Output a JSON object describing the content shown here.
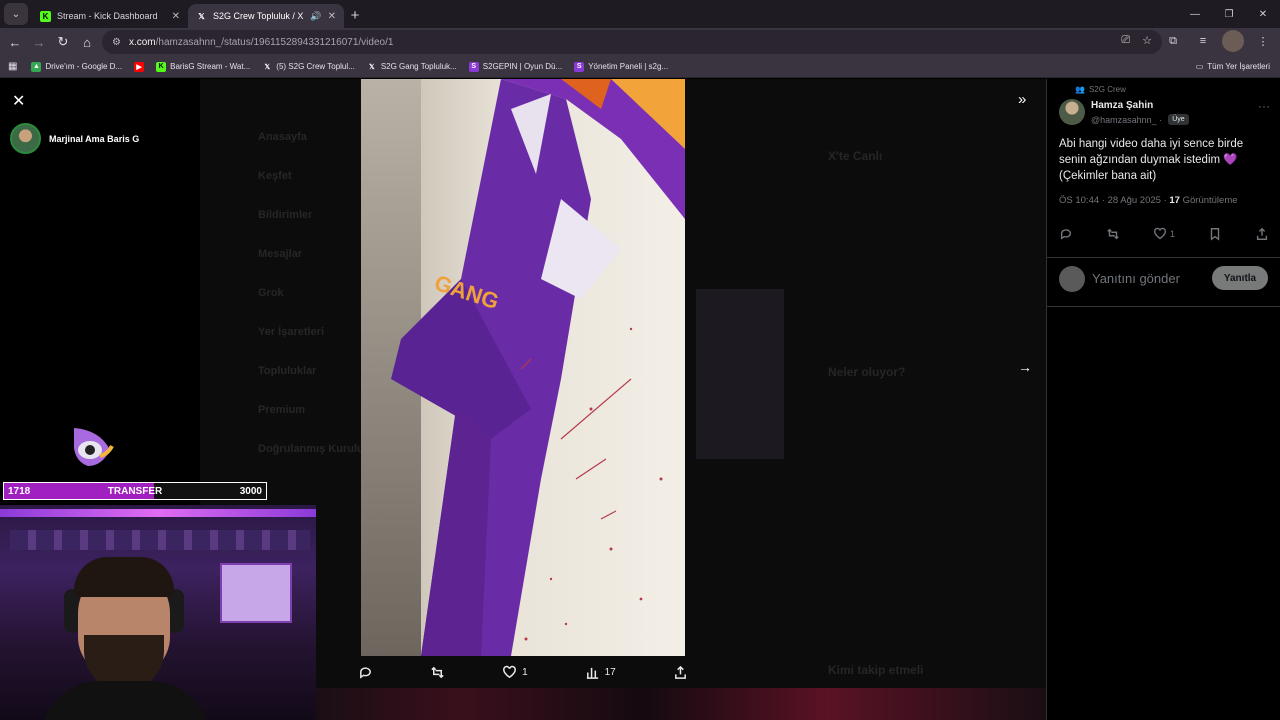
{
  "browser": {
    "tabs": [
      {
        "label": "Stream - Kick Dashboard",
        "favicon": "K",
        "active": false,
        "color": "#53fc18"
      },
      {
        "label": "S2G Crew Topluluk / X",
        "favicon": "X",
        "active": true,
        "color": "#ffffff"
      }
    ],
    "url_host": "x.com",
    "url_path": "/hamzasahnn_/status/1961152894331216071/video/1",
    "bookmarks": [
      {
        "label": "Drive'ım - Google D...",
        "icon": "drive-icon",
        "color": "#34a853"
      },
      {
        "label": "",
        "icon": "youtube-icon",
        "color": "#ff0000"
      },
      {
        "label": "BarisG Stream - Wat...",
        "icon": "kick-icon",
        "color": "#53fc18"
      },
      {
        "label": "(5) S2G Crew Toplul...",
        "icon": "x-icon",
        "color": "#ffffff"
      },
      {
        "label": "S2G Gang Topluluk...",
        "icon": "x-icon",
        "color": "#ffffff"
      },
      {
        "label": "S2GEPIN | Oyun Dü...",
        "icon": "s2g-icon",
        "color": "#8a3ad8"
      },
      {
        "label": "Yönetim Paneli | s2g...",
        "icon": "s2g-icon",
        "color": "#8a3ad8"
      }
    ],
    "all_bookmarks_label": "Tüm Yer İşaretleri"
  },
  "overlay": {
    "streamer_name": "Marjinal Ama Baris G",
    "transfer": {
      "current": "1718",
      "label": "TRANSFER",
      "goal": "3000",
      "progress": 0.573
    }
  },
  "background_ghost": {
    "nav": [
      "Anasayfa",
      "Keşfet",
      "Bildirimler",
      "Mesajlar",
      "Grok",
      "Yer İşaretleri",
      "Topluluklar",
      "Premium",
      "Doğrulanmış Kuruluşlar"
    ],
    "live_title": "X'te Canlı",
    "whats_happening": "Neler oluyor?",
    "who_to_follow": "Kimi takip etmeli"
  },
  "video_toolbar": {
    "reply_count": "",
    "retweet_count": "",
    "like_count": "1",
    "views_count": "17"
  },
  "post": {
    "community": "S2G Crew",
    "author_name": "Hamza Şahin",
    "author_handle": "@hamzasahnn_ ·",
    "badge": "Üye",
    "text_line1": "Abi hangi video daha iyi sence birde",
    "text_line2": "senin ağzından duymak istedim 💜",
    "text_line3": "(Çekimler bana ait)",
    "timestamp": "ÖS 10:44 · 28 Ağu 2025 · ",
    "views": "17",
    "views_label": " Görüntüleme",
    "like_count": "1",
    "reply_placeholder": "Yanıtını gönder",
    "reply_button": "Yanıtla"
  }
}
